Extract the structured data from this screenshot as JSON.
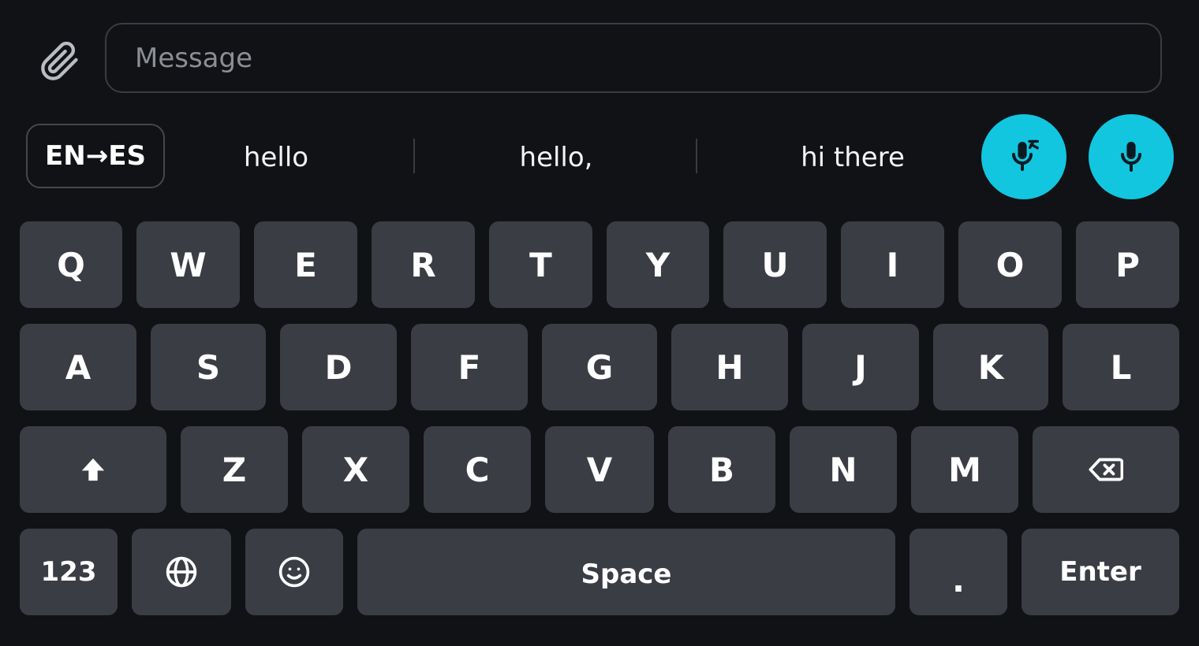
{
  "input": {
    "placeholder": "Message",
    "value": ""
  },
  "icons": {
    "attach": "paperclip-icon",
    "mic_off": "microphone-off-icon",
    "mic": "microphone-icon",
    "shift": "shift-arrow-icon",
    "backspace": "backspace-icon",
    "globe": "globe-icon",
    "emoji": "emoji-smile-icon"
  },
  "toolbar": {
    "language_toggle": "EN→ES"
  },
  "suggestions": [
    "hello",
    "hello,",
    "hi there"
  ],
  "keyboard": {
    "row1": [
      "Q",
      "W",
      "E",
      "R",
      "T",
      "Y",
      "U",
      "I",
      "O",
      "P"
    ],
    "row2": [
      "A",
      "S",
      "D",
      "F",
      "G",
      "H",
      "J",
      "K",
      "L"
    ],
    "row3": [
      "Z",
      "X",
      "C",
      "V",
      "B",
      "N",
      "M"
    ],
    "bottom": {
      "numbers": "123",
      "space": "Space",
      "period": ".",
      "enter": "Enter"
    }
  },
  "colors": {
    "background": "#111215",
    "key": "#3b3d45",
    "accent": "#12c6e0"
  }
}
